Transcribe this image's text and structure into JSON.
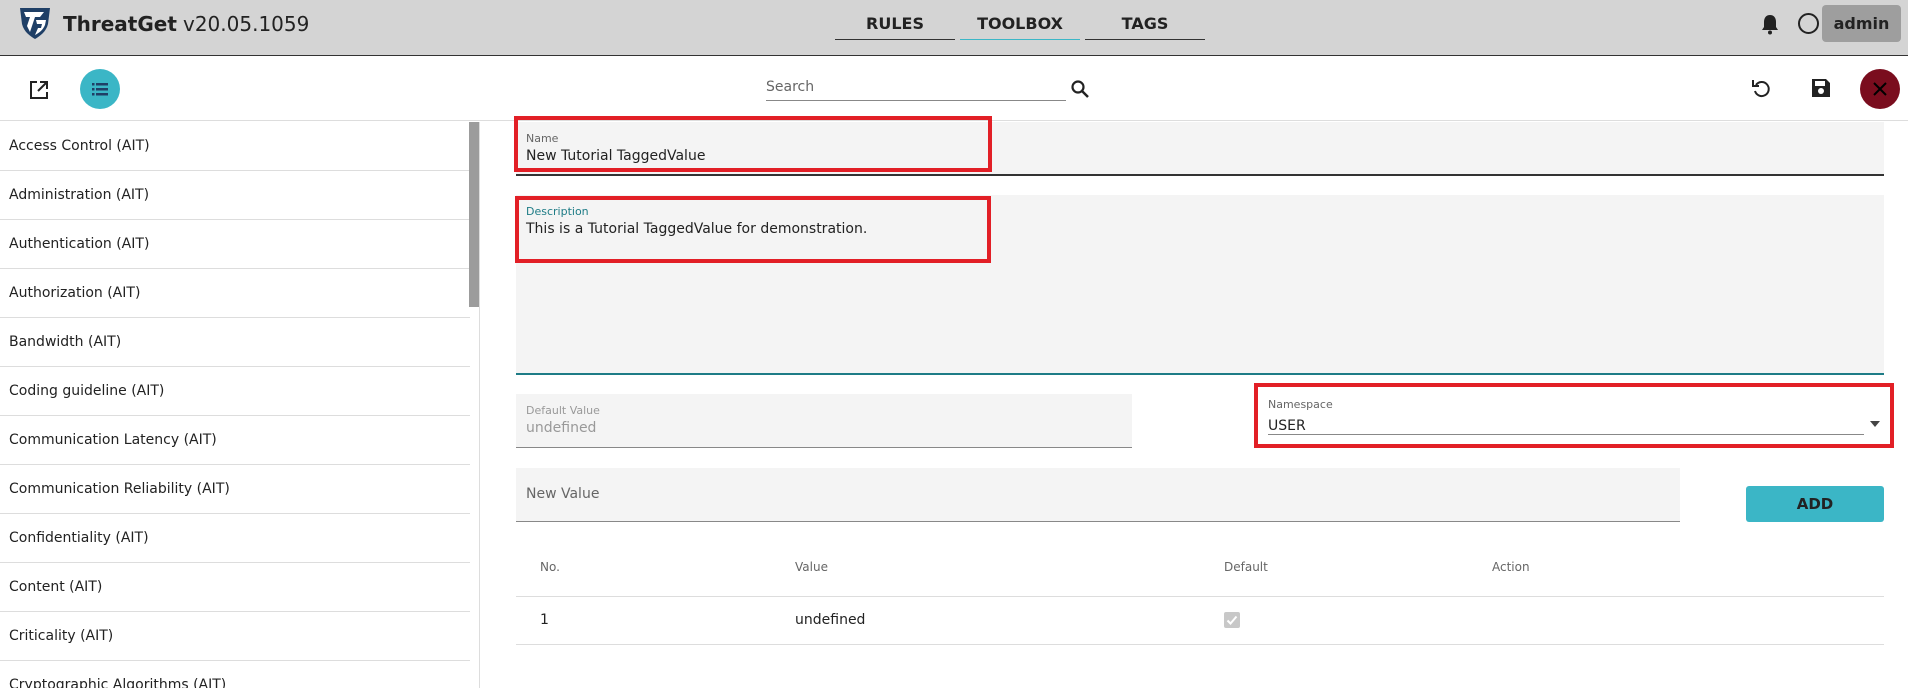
{
  "header": {
    "app_name": "ThreatGet",
    "version": "v20.05.1059",
    "nav_tabs": [
      "RULES",
      "TOOLBOX",
      "TAGS"
    ],
    "active_tab": "TOOLBOX",
    "user": "admin"
  },
  "toolbar": {
    "search_placeholder": "Search"
  },
  "sidebar": {
    "items": [
      "Access Control (AIT)",
      "Administration (AIT)",
      "Authentication (AIT)",
      "Authorization (AIT)",
      "Bandwidth (AIT)",
      "Coding guideline (AIT)",
      "Communication Latency (AIT)",
      "Communication Reliability (AIT)",
      "Confidentiality (AIT)",
      "Content (AIT)",
      "Criticality (AIT)",
      "Cryptographic Algorithms (AIT)"
    ]
  },
  "form": {
    "name_label": "Name",
    "name_value": "New Tutorial TaggedValue",
    "description_label": "Description",
    "description_value": "This is  a Tutorial TaggedValue for demonstration.",
    "default_value_label": "Default Value",
    "default_value_value": "undefined",
    "namespace_label": "Namespace",
    "namespace_value": "USER",
    "new_value_placeholder": "New Value",
    "add_button": "ADD"
  },
  "table": {
    "headers": [
      "No.",
      "Value",
      "Default",
      "Action"
    ],
    "rows": [
      {
        "no": "1",
        "value": "undefined",
        "default": true
      }
    ]
  },
  "colors": {
    "accent": "#3bb6c6",
    "highlight": "#e21f26",
    "close": "#7a0d1e",
    "topbar": "#d4d4d4"
  }
}
